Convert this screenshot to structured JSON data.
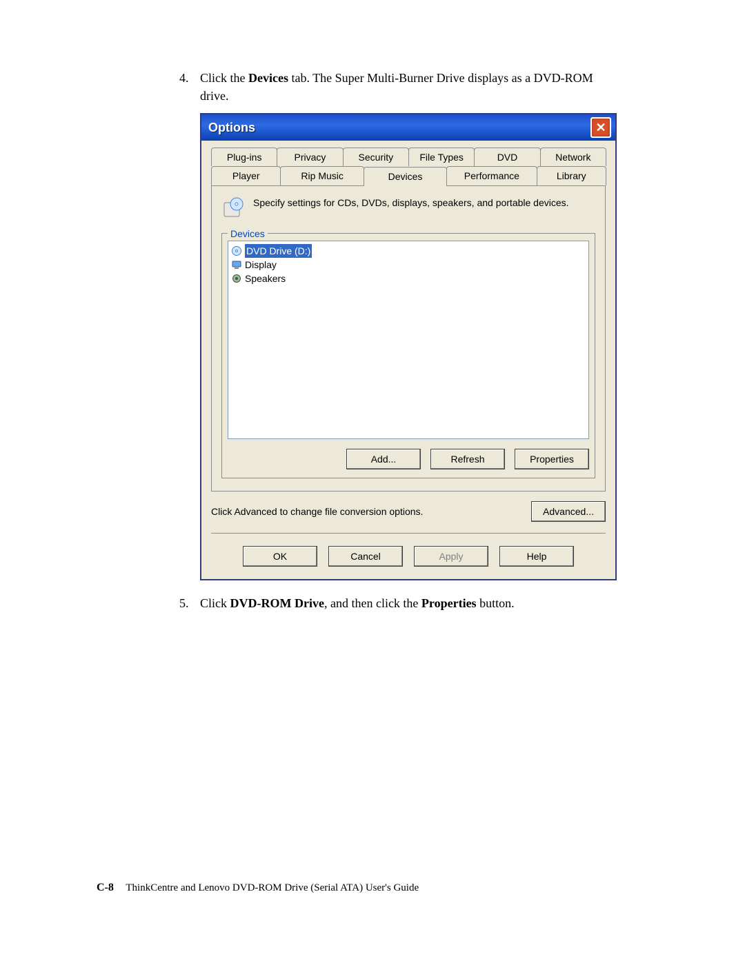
{
  "steps": {
    "item4_num": "4.",
    "item4_a": "Click the ",
    "item4_b": "Devices",
    "item4_c": " tab. The Super Multi-Burner Drive displays as a DVD-ROM drive.",
    "item5_num": "5.",
    "item5_a": "Click ",
    "item5_b": "DVD-ROM Drive",
    "item5_c": ", and then click the ",
    "item5_d": "Properties",
    "item5_e": " button."
  },
  "dialog": {
    "title": "Options",
    "tabs_row1": [
      "Plug-ins",
      "Privacy",
      "Security",
      "File Types",
      "DVD",
      "Network"
    ],
    "tabs_row2": [
      "Player",
      "Rip Music",
      "Devices",
      "Performance",
      "Library"
    ],
    "desc": "Specify settings for CDs, DVDs, displays, speakers, and portable devices.",
    "group_legend": "Devices",
    "items": [
      {
        "label": "DVD Drive (D:)",
        "selected": true,
        "icon": "disc"
      },
      {
        "label": "Display",
        "selected": false,
        "icon": "display"
      },
      {
        "label": "Speakers",
        "selected": false,
        "icon": "speaker"
      }
    ],
    "buttons": {
      "add": "Add...",
      "refresh": "Refresh",
      "properties": "Properties"
    },
    "adv_text": "Click Advanced to change file conversion options.",
    "adv_btn": "Advanced...",
    "ok": "OK",
    "cancel": "Cancel",
    "apply": "Apply",
    "help": "Help"
  },
  "footer": {
    "page": "C-8",
    "text": "ThinkCentre and Lenovo DVD-ROM Drive (Serial ATA) User's Guide"
  }
}
